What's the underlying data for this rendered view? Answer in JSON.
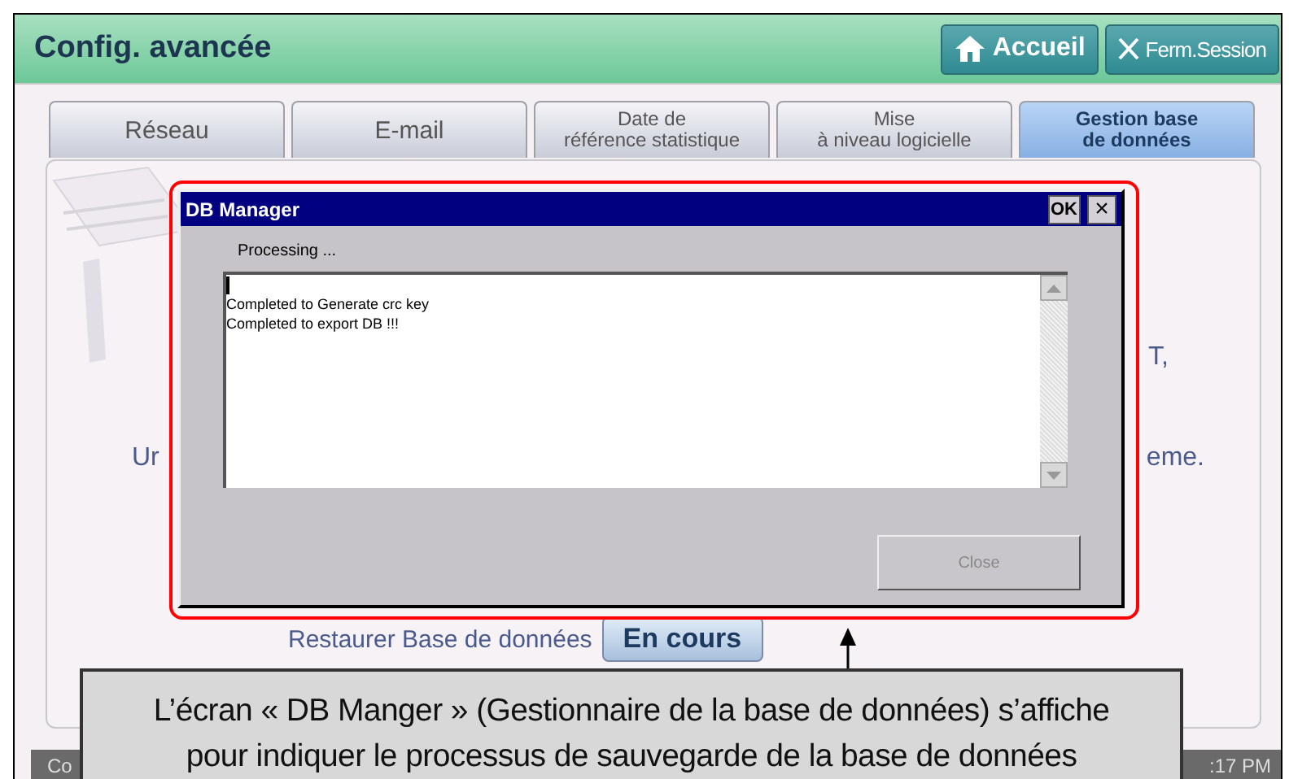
{
  "screen": {
    "title": "Config. avancée",
    "header_buttons": [
      {
        "kind": "home",
        "label": "Accueil"
      },
      {
        "kind": "logout",
        "label": "Ferm.Session"
      }
    ]
  },
  "tabs": [
    {
      "label": "Réseau",
      "selected": false
    },
    {
      "label": "E-mail",
      "selected": false
    },
    {
      "label": "Date de\nréférence statistique",
      "selected": false
    },
    {
      "label": "Mise\nà niveau logicielle",
      "selected": false
    },
    {
      "label": "Gestion base\nde données",
      "selected": true
    }
  ],
  "panel": {
    "fragments": {
      "right_top": "T,",
      "left": "Ur",
      "right": "eme."
    },
    "restore_label": "Restaurer Base de données",
    "restore_button": "En cours"
  },
  "dialog": {
    "title": "DB Manager",
    "title_buttons": [
      {
        "kind": "ok",
        "label": "OK"
      },
      {
        "kind": "close",
        "label": "×"
      }
    ],
    "status": "Processing ...",
    "log": [
      "Completed to Generate crc key",
      "Completed to export DB !!!"
    ],
    "close_button": {
      "label": "Close",
      "disabled": true
    }
  },
  "status_bar": {
    "left": "Co",
    "right": ":17 PM"
  },
  "callout": {
    "lines": [
      "L’écran « DB Manger » (Gestionnaire de la base de données) s’affiche",
      "pour indiquer le processus de sauvegarde de la base de données"
    ]
  }
}
